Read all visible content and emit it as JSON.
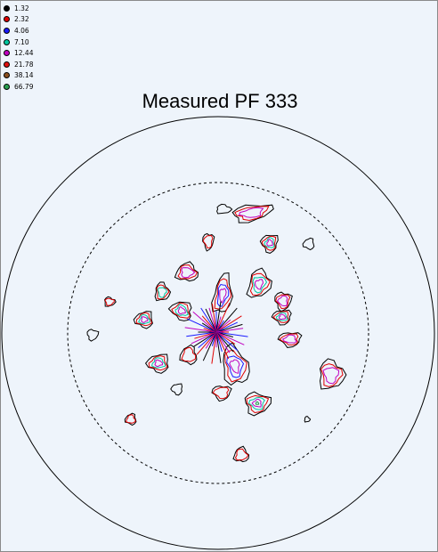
{
  "window": {
    "background": "#eef4fb"
  },
  "plot": {
    "title": "Measured PF 333"
  },
  "legend": {
    "items": [
      {
        "label": "1.32",
        "color": "#000000"
      },
      {
        "label": "2.32",
        "color": "#e00000"
      },
      {
        "label": "4.06",
        "color": "#1a1aff"
      },
      {
        "label": "7.10",
        "color": "#00c8a0"
      },
      {
        "label": "12.44",
        "color": "#c000c0"
      },
      {
        "label": "21.78",
        "color": "#e01010"
      },
      {
        "label": "38.14",
        "color": "#8a4f1f"
      },
      {
        "label": "66.79",
        "color": "#2aa050"
      }
    ]
  },
  "chart_data": {
    "type": "pole-figure-contour",
    "title": "Measured PF 333",
    "contour_levels": [
      1.32,
      2.32,
      4.06,
      7.1,
      12.44,
      21.78,
      38.14,
      66.79
    ],
    "outer_circle": "solid",
    "inner_circle": "dashed",
    "max_level_color": "#2aa050"
  }
}
